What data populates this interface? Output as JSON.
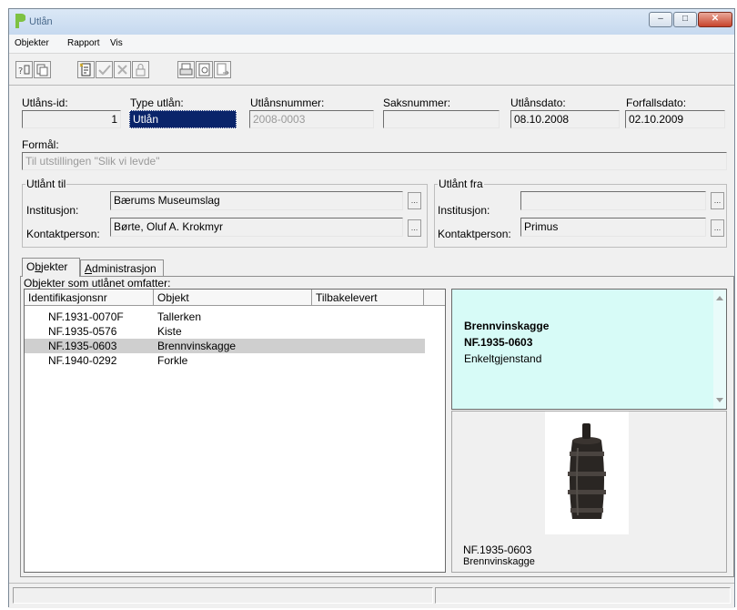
{
  "window": {
    "title": "Utlån",
    "minimize_label": "–",
    "maximize_label": "□",
    "close_label": "✕"
  },
  "menu": [
    "Objekter",
    "Rapport",
    "Vis"
  ],
  "toolbar": {
    "icons": [
      "binoculars-icon",
      "copy-icon",
      "new-record-icon",
      "checkmark-icon",
      "cancel-icon",
      "lock-icon",
      "print-icon",
      "print-preview-icon",
      "export-icon"
    ]
  },
  "header": {
    "id_label": "Utlåns-id:",
    "id_value": "1",
    "type_label": "Type utlån:",
    "type_value": "Utlån",
    "number_label": "Utlånsnummer:",
    "number_value": "2008-0003",
    "case_label": "Saksnummer:",
    "case_value": "",
    "date_label": "Utlånsdato:",
    "date_value": "08.10.2008",
    "due_label": "Forfallsdato:",
    "due_value": "02.10.2009",
    "purpose_label": "Formål:",
    "purpose_value": "Til utstillingen \"Slik vi levde\""
  },
  "lent_to": {
    "title": "Utlånt til",
    "institution_label": "Institusjon:",
    "institution_value": "Bærums Museumslag",
    "contact_label": "Kontaktperson:",
    "contact_value": "Børte, Oluf A. Krokmyr",
    "button_label": "..."
  },
  "lent_from": {
    "title": "Utlånt fra",
    "institution_label": "Institusjon:",
    "institution_value": "",
    "contact_label": "Kontaktperson:",
    "contact_value": "Primus",
    "button_label": "..."
  },
  "tabs": {
    "objects": {
      "pre": "O",
      "key": "b",
      "post": "jekter"
    },
    "admin": {
      "pre": "",
      "key": "A",
      "post": "dministrasjon"
    }
  },
  "objects_panel": {
    "caption": "Objekter som utlånet omfatter:",
    "columns": [
      "Identifikasjonsnr",
      "Objekt",
      "Tilbakelevert"
    ],
    "rows": [
      {
        "id": "NF.1931-0070F",
        "object": "Tallerken",
        "returned": ""
      },
      {
        "id": "NF.1935-0576",
        "object": "Kiste",
        "returned": ""
      },
      {
        "id": "NF.1935-0603",
        "object": "Brennvinskagge",
        "returned": ""
      },
      {
        "id": "NF.1940-0292",
        "object": "Forkle",
        "returned": ""
      }
    ],
    "selected_index": 2
  },
  "detail": {
    "name": "Brennvinskagge",
    "id": "NF.1935-0603",
    "kind": "Enkeltgjenstand",
    "image_caption_id": "NF.1935-0603",
    "image_caption_name": "Brennvinskagge"
  },
  "colors": {
    "accent_selection": "#0a246a",
    "info_background": "#d7fbf7",
    "row_selection": "#cfcfcf"
  }
}
